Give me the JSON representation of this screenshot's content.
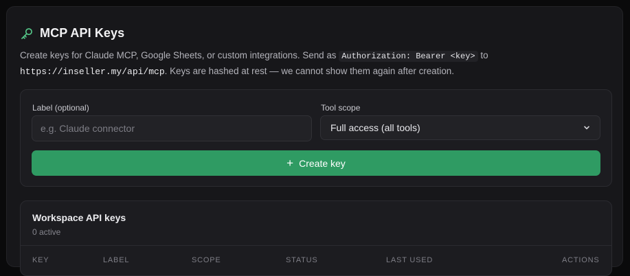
{
  "header": {
    "title": "MCP API Keys",
    "icon": "key-icon"
  },
  "description": {
    "part1": "Create keys for Claude MCP, Google Sheets, or custom integrations. Send as ",
    "code": "Authorization: Bearer <key>",
    "part2": " to",
    "url": "https://inseller.my/api/mcp",
    "part3": ". Keys are hashed at rest — we cannot show them again after creation."
  },
  "form": {
    "label_label": "Label (optional)",
    "label_placeholder": "e.g. Claude connector",
    "label_value": "",
    "scope_label": "Tool scope",
    "scope_value": "Full access (all tools)",
    "create_button": "Create key"
  },
  "keys": {
    "title": "Workspace API keys",
    "count": "0 active",
    "columns": [
      "Key",
      "Label",
      "Scope",
      "Status",
      "Last used",
      "Actions"
    ]
  },
  "colors": {
    "accent": "#2f9b63",
    "icon_green": "#56c98a",
    "panel": "#17171a"
  }
}
